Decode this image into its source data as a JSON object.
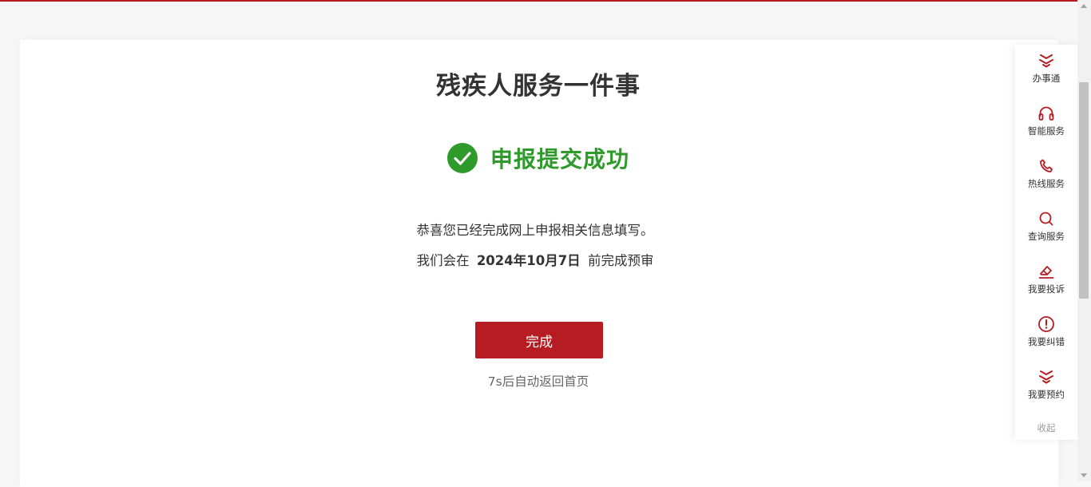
{
  "header": {
    "accent_color": "#b71c22"
  },
  "main": {
    "title": "残疾人服务一件事",
    "status": {
      "icon": "check-circle-icon",
      "text": "申报提交成功",
      "color": "#2e9a2a"
    },
    "message_line1": "恭喜您已经完成网上申报相关信息填写。",
    "message_line2_prefix": "我们会在",
    "message_line2_date": "2024年10月7日",
    "message_line2_suffix": "前完成预审",
    "done_button_label": "完成",
    "countdown_text": "7s后自动返回首页"
  },
  "sidebar": {
    "items": [
      {
        "label": "办事通",
        "icon": "banshitong-logo-icon"
      },
      {
        "label": "智能服务",
        "icon": "headset-icon"
      },
      {
        "label": "热线服务",
        "icon": "phone-icon"
      },
      {
        "label": "查询服务",
        "icon": "search-icon"
      },
      {
        "label": "我要投诉",
        "icon": "pen-complaint-icon"
      },
      {
        "label": "我要纠错",
        "icon": "exclamation-circle-icon"
      },
      {
        "label": "我要预约",
        "icon": "banshitong-logo-icon"
      }
    ],
    "collapse_label": "收起"
  }
}
